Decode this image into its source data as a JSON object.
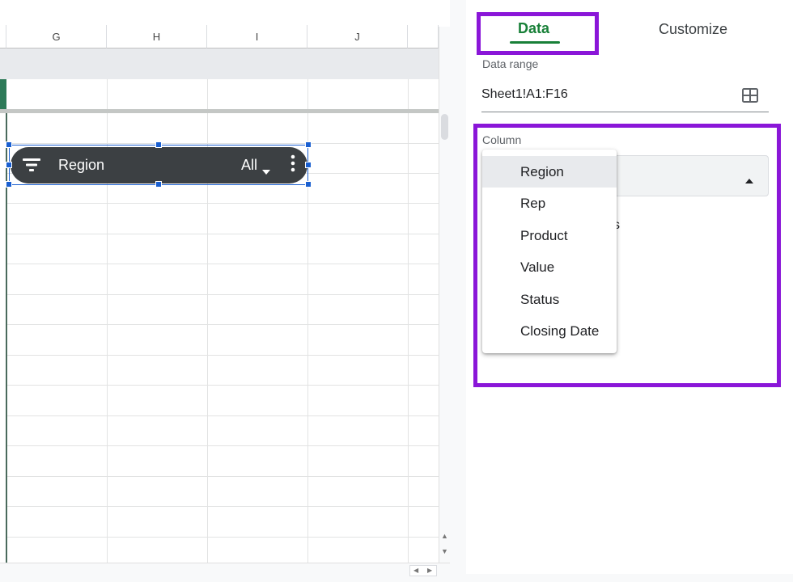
{
  "sheet": {
    "columns": [
      "G",
      "H",
      "I",
      "J"
    ],
    "slicer": {
      "label": "Region",
      "value": "All"
    }
  },
  "panel": {
    "tabs": {
      "data": "Data",
      "customize": "Customize"
    },
    "data_range": {
      "label": "Data range",
      "value": "Sheet1!A1:F16"
    },
    "column": {
      "label": "Column",
      "partial_text": "s",
      "options": [
        "Region",
        "Rep",
        "Product",
        "Value",
        "Status",
        "Closing Date"
      ]
    }
  },
  "colors": {
    "accent_green": "#188038",
    "highlight_purple": "#8a16d8",
    "selection_blue": "#1a5fd0",
    "slicer_bg": "#3c4043"
  }
}
